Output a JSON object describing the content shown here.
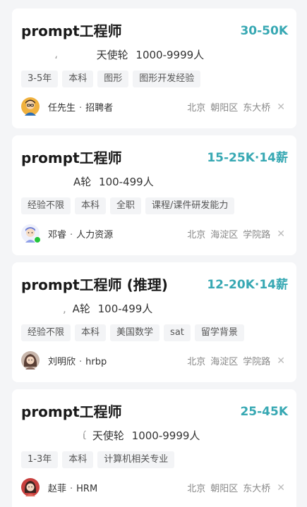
{
  "jobs": [
    {
      "title": "prompt工程师",
      "salary": "30-50K",
      "company_blur": "،",
      "company_stage": "天使轮",
      "company_size": "1000-9999人",
      "tags": [
        "3-5年",
        "本科",
        "图形",
        "图形开发经验"
      ],
      "recruiter_name": "任先生",
      "recruiter_role": "招聘者",
      "city": "北京",
      "district": "朝阳区",
      "area": "东大桥",
      "online": false,
      "avatar_color": "#e8a53c"
    },
    {
      "title": "prompt工程师",
      "salary": "15-25K·14薪",
      "company_blur": "",
      "company_stage": "A轮",
      "company_size": "100-499人",
      "tags": [
        "经验不限",
        "本科",
        "全职",
        "课程/课件研发能力"
      ],
      "recruiter_name": "邓睿",
      "recruiter_role": "人力资源",
      "city": "北京",
      "district": "海淀区",
      "area": "学院路",
      "online": true,
      "avatar_color": "#8e9be0"
    },
    {
      "title": "prompt工程师 (推理)",
      "salary": "12-20K·14薪",
      "company_blur": ",",
      "company_stage": "A轮",
      "company_size": "100-499人",
      "tags": [
        "经验不限",
        "本科",
        "美国数学",
        "sat",
        "留学背景"
      ],
      "recruiter_name": "刘明欣",
      "recruiter_role": "hrbp",
      "city": "北京",
      "district": "海淀区",
      "area": "学院路",
      "online": false,
      "avatar_color": "#a07a6a"
    },
    {
      "title": "prompt工程师",
      "salary": "25-45K",
      "company_blur": "ί",
      "company_stage": "天使轮",
      "company_size": "1000-9999人",
      "tags": [
        "1-3年",
        "本科",
        "计算机相关专业"
      ],
      "recruiter_name": "赵菲",
      "recruiter_role": "HRM",
      "city": "北京",
      "district": "朝阳区",
      "area": "东大桥",
      "online": false,
      "avatar_color": "#c9413f"
    }
  ],
  "dot_separator": "·",
  "close_icon": "close-icon",
  "colors": {
    "salary": "#37a8b3",
    "background": "#f4f5f7",
    "card": "#ffffff",
    "tag_bg": "#f3f4f6",
    "online": "#25c43d"
  }
}
